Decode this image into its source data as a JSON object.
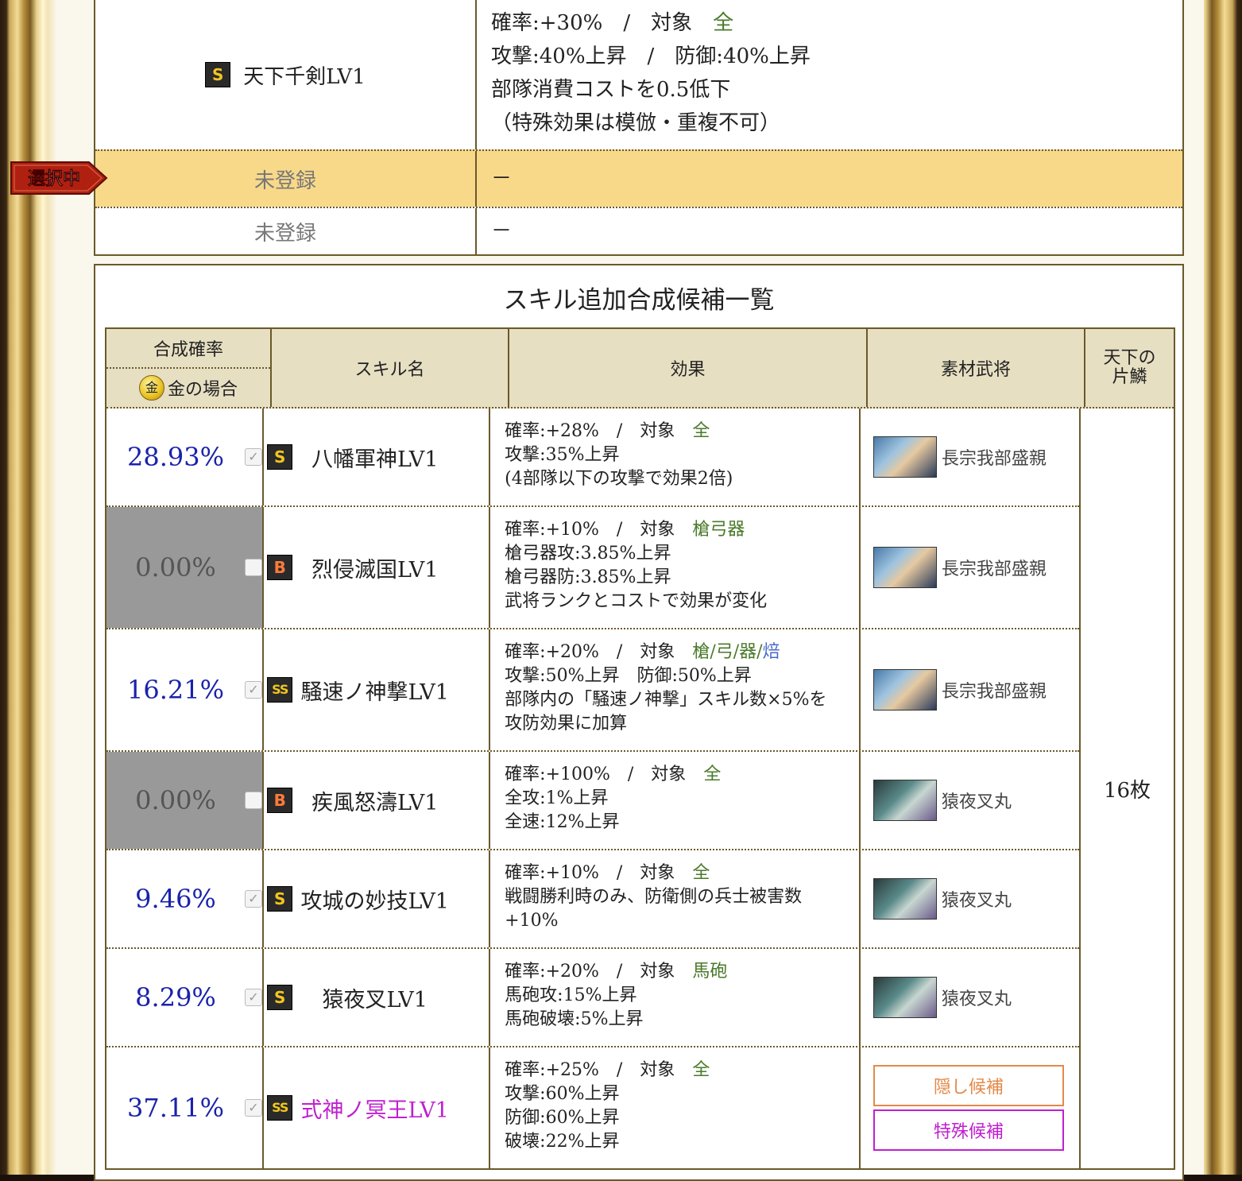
{
  "colors": {
    "accent_green": "#4a7a2a",
    "rate_blue": "#1a22aa",
    "selected_bg": "#f8d98a",
    "special_magenta": "#c020d0",
    "hidden_orange": "#e38a4a"
  },
  "top_skills": [
    {
      "rank": "S",
      "name": "天下千剣LV1",
      "effect_lines": [
        {
          "prefix": "確率:+30%　/　対象　",
          "target": "全"
        },
        {
          "text": "攻撃:40%上昇　/　防御:40%上昇"
        },
        {
          "text": "部隊消費コストを0.5低下"
        },
        {
          "text": "（特殊効果は模倣・重複不可）"
        }
      ]
    },
    {
      "name": "未登録",
      "effect": "－",
      "selected": true
    },
    {
      "name": "未登録",
      "effect": "－"
    }
  ],
  "selected_badge": "選択中",
  "panel": {
    "title": "スキル追加合成候補一覧",
    "headers": {
      "rate_top": "合成確率",
      "rate_bottom": "金の場合",
      "gold_icon_glyph": "金",
      "skill": "スキル名",
      "effect": "効果",
      "material": "素材武将",
      "tenka_line1": "天下の",
      "tenka_line2": "片鱗"
    },
    "tenka_count": "16枚",
    "rows": [
      {
        "rate": "28.93%",
        "checked": true,
        "rank": "S",
        "skill": "八幡軍神LV1",
        "eff1_prefix": "確率:+28%　/　対象　",
        "eff1_target": "全",
        "eff_lines": [
          "攻撃:35%上昇",
          "(4部隊以下の攻撃で効果2倍)"
        ],
        "material": "長宗我部盛親"
      },
      {
        "rate": "0.00%",
        "checked": false,
        "rank": "B",
        "skill": "烈侵滅国LV1",
        "eff1_prefix": "確率:+10%　/　対象　",
        "eff1_target": "槍弓器",
        "eff_lines": [
          "槍弓器攻:3.85%上昇",
          "槍弓器防:3.85%上昇",
          "武将ランクとコストで効果が変化"
        ],
        "material": "長宗我部盛親"
      },
      {
        "rate": "16.21%",
        "checked": true,
        "rank": "SS",
        "skill": "騒速ノ神撃LV1",
        "eff1_prefix": "確率:+20%　/　対象　",
        "eff1_target": "槍/弓/器/",
        "eff1_target2": "焙",
        "eff_lines": [
          "攻撃:50%上昇　防御:50%上昇",
          "部隊内の「騒速ノ神撃」スキル数×5%を",
          "攻防効果に加算"
        ],
        "material": "長宗我部盛親"
      },
      {
        "rate": "0.00%",
        "checked": false,
        "rank": "B",
        "skill": "疾風怒濤LV1",
        "eff1_prefix": "確率:+100%　/　対象　",
        "eff1_target": "全",
        "eff_lines": [
          "全攻:1%上昇",
          "全速:12%上昇"
        ],
        "material": "猿夜叉丸"
      },
      {
        "rate": "9.46%",
        "checked": true,
        "rank": "S",
        "skill": "攻城の妙技LV1",
        "eff1_prefix": "確率:+10%　/　対象　",
        "eff1_target": "全",
        "eff_lines": [
          "戦闘勝利時のみ、防衛側の兵士被害数",
          "+10%"
        ],
        "material": "猿夜叉丸"
      },
      {
        "rate": "8.29%",
        "checked": true,
        "rank": "S",
        "skill": "猿夜叉LV1",
        "eff1_prefix": "確率:+20%　/　対象　",
        "eff1_target": "馬砲",
        "eff_lines": [
          "馬砲攻:15%上昇",
          "馬砲破壊:5%上昇"
        ],
        "material": "猿夜叉丸"
      },
      {
        "rate": "37.11%",
        "checked": true,
        "rank": "SS",
        "skill": "式神ノ冥王LV1",
        "eff1_prefix": "確率:+25%　/　対象　",
        "eff1_target": "全",
        "eff_lines": [
          "攻撃:60%上昇",
          "防御:60%上昇",
          "破壊:22%上昇"
        ],
        "buttons": [
          "隠し候補",
          "特殊候補"
        ]
      }
    ]
  }
}
